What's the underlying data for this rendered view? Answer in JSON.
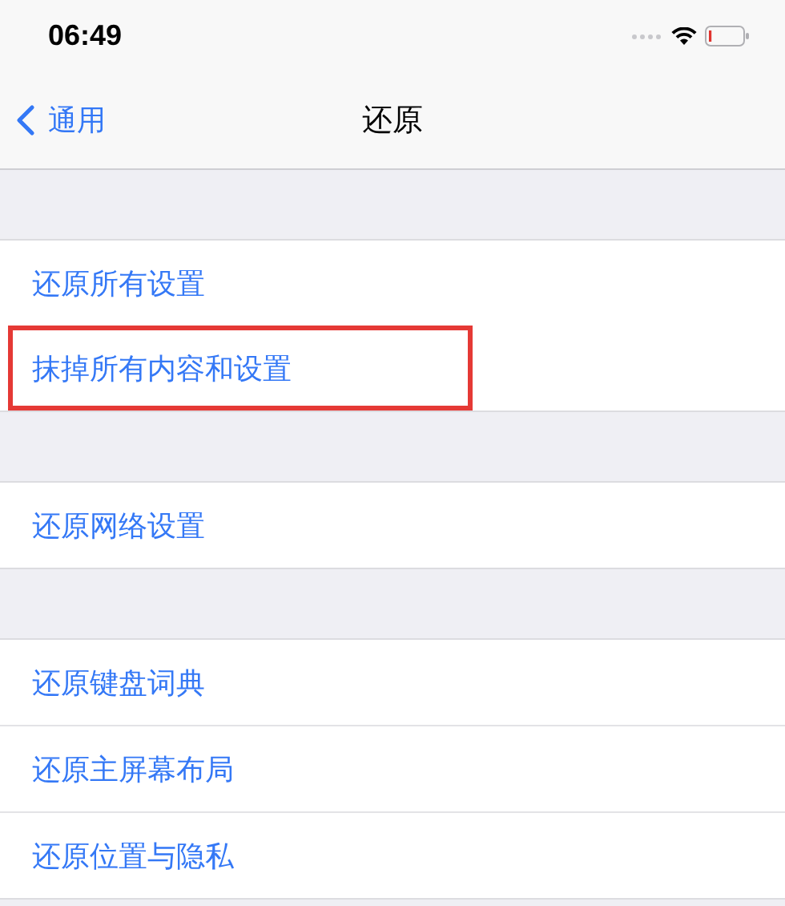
{
  "status_bar": {
    "time": "06:49"
  },
  "nav": {
    "back": "通用",
    "title": "还原"
  },
  "groups": [
    [
      {
        "label": "还原所有设置",
        "highlighted": false
      },
      {
        "label": "抹掉所有内容和设置",
        "highlighted": true
      }
    ],
    [
      {
        "label": "还原网络设置",
        "highlighted": false
      }
    ],
    [
      {
        "label": "还原键盘词典",
        "highlighted": false
      },
      {
        "label": "还原主屏幕布局",
        "highlighted": false
      },
      {
        "label": "还原位置与隐私",
        "highlighted": false
      }
    ]
  ]
}
